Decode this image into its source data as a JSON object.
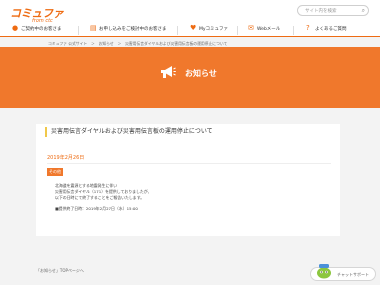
{
  "header": {
    "logo": "コミュファ",
    "logo_sub": "from ctc",
    "search_placeholder": "サイト内を検索"
  },
  "nav": {
    "items": [
      {
        "label": "ご契約中のお客さま",
        "icon": "person-icon"
      },
      {
        "label": "お申し込みをご検討中のお客さま",
        "icon": "document-icon"
      },
      {
        "label": "Myコミュファ",
        "icon": "heart-icon"
      },
      {
        "label": "Webメール",
        "icon": "mail-icon"
      },
      {
        "label": "よくあるご質問",
        "icon": "question-icon"
      }
    ]
  },
  "breadcrumb": "コミュファ 公式サイト　＞　お知らせ　＞　災害用伝言ダイヤルおよび災害用伝言板の運用停止について",
  "banner": {
    "title": "お知らせ",
    "icon": "megaphone-icon"
  },
  "article": {
    "title": "災害用伝言ダイヤルおよび災害用伝言板の運用停止について",
    "date": "2019年2月26日",
    "category": "その他",
    "body": [
      "北海道を震源とする地震発生に伴い",
      "災害用伝言ダイヤル（171）を提供しておりましたが、",
      "以下の日時にて終了することをご報告いたします。",
      "",
      "■提供終了日時：2019年2月27日（水）15:00"
    ]
  },
  "back_link": "「お知らせ」TOPページへ",
  "chat": {
    "label": "チャットサポート"
  },
  "colors": {
    "brand_orange": "#f0782c",
    "title_accent": "#f0c84a"
  }
}
